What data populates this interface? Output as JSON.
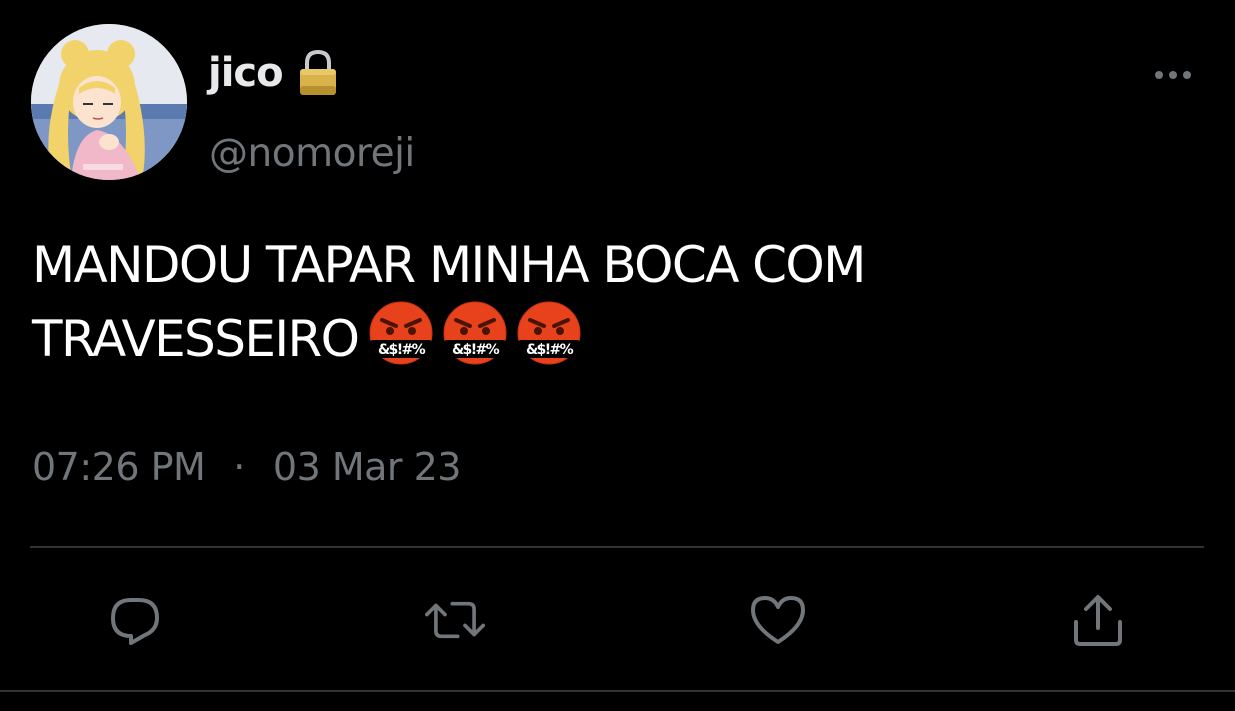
{
  "author": {
    "display_name": "jico",
    "handle": "@nomoreji",
    "locked": true
  },
  "tweet": {
    "text": "MANDOU TAPAR MINHA BOCA COM TRAVESSEIRO",
    "emojis": [
      "face-with-symbols-on-mouth",
      "face-with-symbols-on-mouth",
      "face-with-symbols-on-mouth"
    ],
    "emoji_symbol_text": "&$!#%"
  },
  "meta": {
    "time": "07:26 PM",
    "separator": "·",
    "date": "03 Mar 23"
  },
  "actions": [
    {
      "name": "reply",
      "icon": "reply-icon"
    },
    {
      "name": "retweet",
      "icon": "retweet-icon"
    },
    {
      "name": "like",
      "icon": "heart-icon"
    },
    {
      "name": "share",
      "icon": "share-icon"
    }
  ],
  "colors": {
    "background": "#000000",
    "text_primary": "#ffffff",
    "text_secondary": "#71767b",
    "divider": "#2f3336",
    "emoji_face": "#e8421c"
  }
}
